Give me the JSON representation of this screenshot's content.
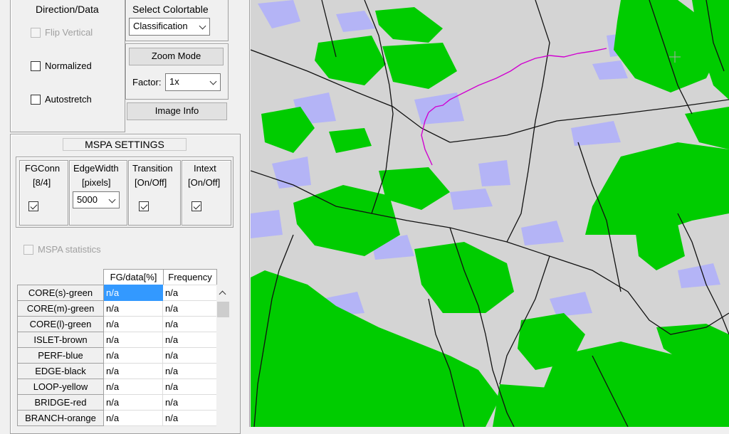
{
  "direction": {
    "title": "Direction/Data",
    "flip_vertical": "Flip Vertical",
    "normalized": "Normalized",
    "autostretch": "Autostretch"
  },
  "colortable": {
    "title": "Select Colortable",
    "value": "Classification"
  },
  "zoom": {
    "button": "Zoom Mode",
    "factor_label": "Factor:",
    "factor_value": "1x",
    "image_info": "Image Info"
  },
  "mspa": {
    "title": "MSPA SETTINGS",
    "fgconn": {
      "l1": "FGConn",
      "l2": "[8/4]",
      "checked": true
    },
    "edgewidth": {
      "l1": "EdgeWidth",
      "l2": "[pixels]",
      "value": "5000"
    },
    "transition": {
      "l1": "Transition",
      "l2": "[On/Off]",
      "checked": true
    },
    "intext": {
      "l1": "Intext",
      "l2": "[On/Off]",
      "checked": true
    },
    "statistics": "MSPA statistics"
  },
  "table": {
    "headers": [
      "FG/data[%]",
      "Frequency"
    ],
    "rows": [
      {
        "name": "CORE(s)-green",
        "fg": "n/a",
        "freq": "n/a"
      },
      {
        "name": "CORE(m)-green",
        "fg": "n/a",
        "freq": "n/a"
      },
      {
        "name": "CORE(l)-green",
        "fg": "n/a",
        "freq": "n/a"
      },
      {
        "name": "ISLET-brown",
        "fg": "n/a",
        "freq": "n/a"
      },
      {
        "name": "PERF-blue",
        "fg": "n/a",
        "freq": "n/a"
      },
      {
        "name": "EDGE-black",
        "fg": "n/a",
        "freq": "n/a"
      },
      {
        "name": "LOOP-yellow",
        "fg": "n/a",
        "freq": "n/a"
      },
      {
        "name": "BRIDGE-red",
        "fg": "n/a",
        "freq": "n/a"
      },
      {
        "name": "BRANCH-orange",
        "fg": "n/a",
        "freq": "n/a"
      }
    ]
  },
  "colors": {
    "core_green": "#00cc00",
    "background_gray": "#d4d4d4",
    "water_blue": "#b4b4f6",
    "edge_black": "#000000",
    "path_magenta": "#d000d0"
  }
}
